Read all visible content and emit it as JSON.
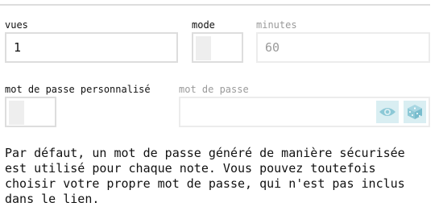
{
  "fields": {
    "vues": {
      "label": "vues",
      "value": "1"
    },
    "mode": {
      "label": "mode",
      "checked": false
    },
    "minutes": {
      "label": "minutes",
      "value": "60",
      "disabled": true
    },
    "custom_password": {
      "label": "mot de passe personnalisé",
      "checked": false
    },
    "password": {
      "label": "mot de passe",
      "value": "",
      "disabled": true
    }
  },
  "icons": {
    "show_password": "eye-icon",
    "generate_password": "cube-icon"
  },
  "colors": {
    "border": "#dddddd",
    "disabled_text": "#9a9a9a",
    "icon_button_bg": "#d9eef2",
    "icon_color": "#8cc8d6"
  },
  "description": "Par défaut, un mot de passe généré de manière sécurisée\nest utilisé pour chaque note. Vous pouvez toutefois\nchoisir votre propre mot de passe, qui n'est pas inclus\ndans le lien."
}
